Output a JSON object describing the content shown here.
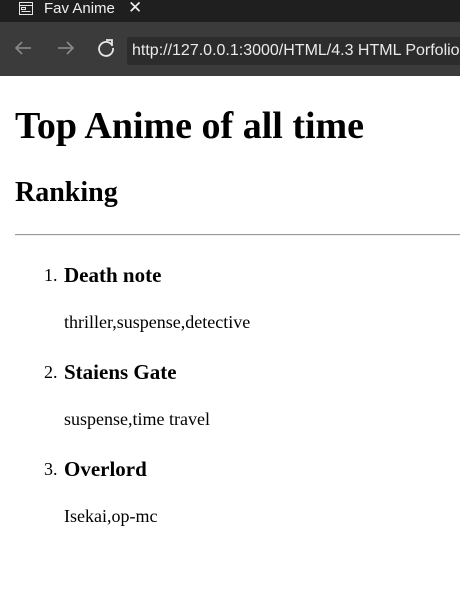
{
  "tab": {
    "title": "Fav Anime",
    "close_symbol": "✕",
    "icon": "page-icon"
  },
  "toolbar": {
    "back_icon": "back-arrow-icon",
    "forward_icon": "forward-arrow-icon",
    "reload_icon": "reload-icon",
    "url": "http://127.0.0.1:3000/HTML/4.3 HTML Porfolio"
  },
  "page": {
    "heading": "Top Anime of all time",
    "subheading": "Ranking",
    "ranking": [
      {
        "number": "1.",
        "title": "Death note",
        "genres": "thriller,suspense,detective"
      },
      {
        "number": "2.",
        "title": "Staiens Gate",
        "genres": "suspense,time travel"
      },
      {
        "number": "3.",
        "title": "Overlord",
        "genres": "Isekai,op-mc"
      }
    ]
  },
  "colors": {
    "tabbar_bg": "#1f1f1f",
    "toolbar_bg": "#3b3b3b",
    "urlbar_bg": "#2c2c2c",
    "page_bg": "#ffffff"
  }
}
